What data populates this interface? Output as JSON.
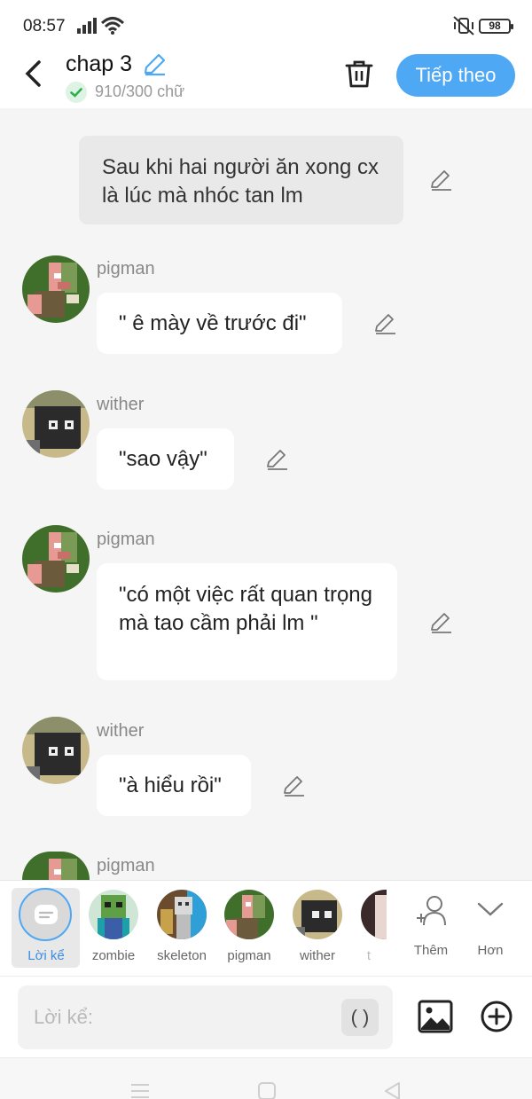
{
  "status": {
    "time": "08:57",
    "battery": "98"
  },
  "header": {
    "title": "chap 3",
    "word_count": "910/300 chữ",
    "next_label": "Tiếp theo"
  },
  "messages": [
    {
      "type": "narration",
      "text": "Sau khi hai người ăn xong cx là lúc mà nhóc tan lm"
    },
    {
      "type": "dialogue",
      "speaker": "pigman",
      "text": "\" ê mày về trước đi\""
    },
    {
      "type": "dialogue",
      "speaker": "wither",
      "text": "\"sao vậy\""
    },
    {
      "type": "dialogue",
      "speaker": "pigman",
      "text": "\"có một việc rất quan trọng mà tao cầm phải lm \""
    },
    {
      "type": "dialogue",
      "speaker": "wither",
      "text": "\"à hiểu rồi\""
    },
    {
      "type": "dialogue",
      "speaker": "pigman",
      "text": ""
    }
  ],
  "characters": [
    {
      "name": "Lời kể",
      "selected": true
    },
    {
      "name": "zombie"
    },
    {
      "name": "skeleton"
    },
    {
      "name": "pigman"
    },
    {
      "name": "wither"
    },
    {
      "name": "t"
    }
  ],
  "actions": {
    "add_label": "Thêm",
    "more_label": "Hơn"
  },
  "input": {
    "placeholder": "Lời kể:",
    "paren_label": "( )"
  },
  "colors": {
    "accent": "#4fa8f3",
    "success": "#2bb24c"
  }
}
